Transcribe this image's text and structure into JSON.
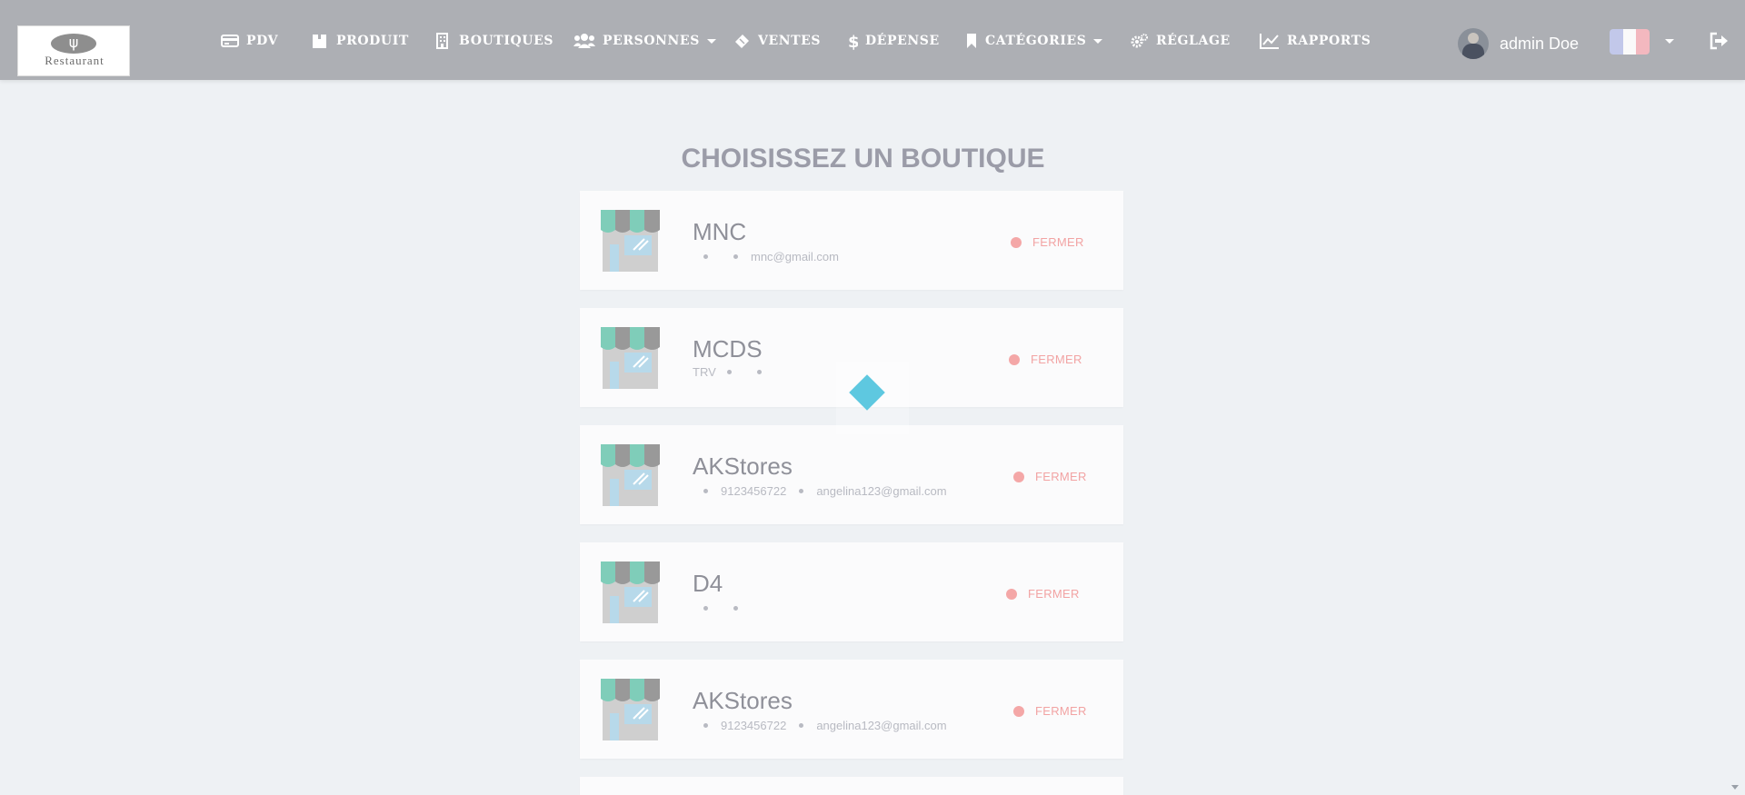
{
  "nav": {
    "items": [
      {
        "label": "PDV",
        "icon": "credit-card-icon",
        "dropdown": false
      },
      {
        "label": "PRODUIT",
        "icon": "box-icon",
        "dropdown": false
      },
      {
        "label": "BOUTIQUES",
        "icon": "building-icon",
        "dropdown": false
      },
      {
        "label": "PERSONNES",
        "icon": "users-icon",
        "dropdown": true
      },
      {
        "label": "VENTES",
        "icon": "ticket-icon",
        "dropdown": false
      },
      {
        "label": "DÉPENSE",
        "icon": "dollar-icon",
        "dropdown": false
      },
      {
        "label": "CATÉGORIES",
        "icon": "bookmark-icon",
        "dropdown": true
      },
      {
        "label": "RÉGLAGE",
        "icon": "gears-icon",
        "dropdown": false
      },
      {
        "label": "RAPPORTS",
        "icon": "line-chart-icon",
        "dropdown": false
      }
    ],
    "user_name": "admin Doe",
    "language_flag": "fr-flag-icon"
  },
  "logo": {
    "text": "Restaurant"
  },
  "page_title": "CHOISISSEZ UN BOUTIQUE",
  "stores": [
    {
      "name": "MNC",
      "meta": [
        "",
        "",
        "mnc@gmail.com"
      ],
      "status": "FERMER"
    },
    {
      "name": "MCDS",
      "meta": [
        "TRV",
        "",
        ""
      ],
      "status": "FERMER"
    },
    {
      "name": "AKStores",
      "meta": [
        "",
        "9123456722",
        "angelina123@gmail.com"
      ],
      "status": "FERMER"
    },
    {
      "name": "D4",
      "meta": [
        "",
        "",
        ""
      ],
      "status": "FERMER"
    },
    {
      "name": "AKStores",
      "meta": [
        "",
        "9123456722",
        "angelina123@gmail.com"
      ],
      "status": "FERMER"
    }
  ],
  "colors": {
    "navbar": "#adafb4",
    "background": "#eef1f4",
    "status_closed": "#f4a7a7",
    "loader": "#5ec8e0"
  }
}
